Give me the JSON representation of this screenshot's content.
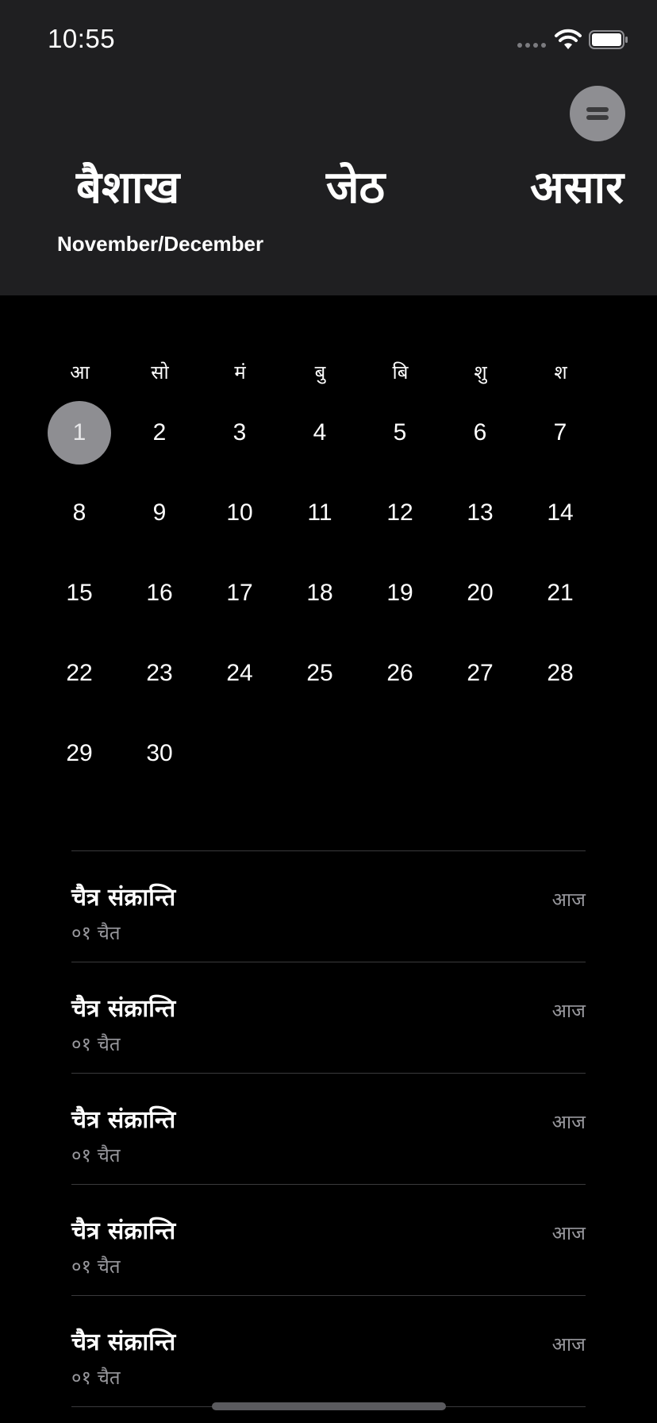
{
  "status_bar": {
    "time": "10:55",
    "icons": [
      "signal-dots-icon",
      "wifi-icon",
      "battery-icon"
    ]
  },
  "header": {
    "menu_icon": "menu-icon",
    "months": [
      "बैशाख",
      "जेठ",
      "असार"
    ],
    "gregorian": "November/December"
  },
  "calendar": {
    "weekdays": [
      "आ",
      "सो",
      "मं",
      "बु",
      "बि",
      "शु",
      "श"
    ],
    "days": [
      "1",
      "2",
      "3",
      "4",
      "5",
      "6",
      "7",
      "8",
      "9",
      "10",
      "11",
      "12",
      "13",
      "14",
      "15",
      "16",
      "17",
      "18",
      "19",
      "20",
      "21",
      "22",
      "23",
      "24",
      "25",
      "26",
      "27",
      "28",
      "29",
      "30"
    ],
    "selected_day": "1"
  },
  "events": [
    {
      "title": "चैत्र संक्रान्ति",
      "date": "०१ चैत",
      "when": "आज"
    },
    {
      "title": "चैत्र संक्रान्ति",
      "date": "०१ चैत",
      "when": "आज"
    },
    {
      "title": "चैत्र संक्रान्ति",
      "date": "०१ चैत",
      "when": "आज"
    },
    {
      "title": "चैत्र संक्रान्ति",
      "date": "०१ चैत",
      "when": "आज"
    },
    {
      "title": "चैत्र संक्रान्ति",
      "date": "०१ चैत",
      "when": "आज"
    }
  ],
  "colors": {
    "header_bg": "#1f1f21",
    "body_bg": "#000000",
    "selected_day_bg": "#8e8e92",
    "secondary_text": "#98989d"
  }
}
